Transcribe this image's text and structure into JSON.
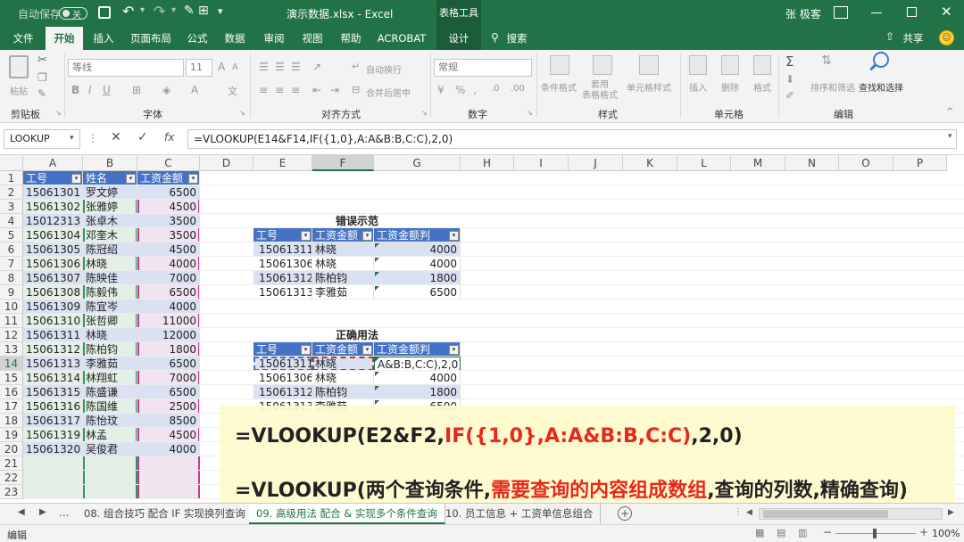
{
  "titlebar": {
    "autosave": "自动保存",
    "autosave_state": "关",
    "title": "演示数据.xlsx - Excel",
    "context_tab": "表格工具",
    "user": "张 极客"
  },
  "tabs": [
    "文件",
    "开始",
    "插入",
    "页面布局",
    "公式",
    "数据",
    "审阅",
    "视图",
    "帮助",
    "ACROBAT",
    "设计",
    "搜索"
  ],
  "tabs_right": {
    "share": "共享"
  },
  "ribbon": {
    "groups": [
      "剪贴板",
      "字体",
      "对齐方式",
      "数字",
      "样式",
      "单元格",
      "编辑"
    ],
    "paste": "粘贴",
    "font_name": "等线",
    "font_size": "11",
    "wrap": "自动换行",
    "merge": "合并后居中",
    "number_format": "常规",
    "cond_format": "条件格式",
    "table_format": "套用\n表格格式",
    "cell_style": "单元格样式",
    "insert": "插入",
    "delete": "删除",
    "format": "格式",
    "sort": "排序和筛选",
    "find": "查找和选择"
  },
  "formula_bar": {
    "name_box": "LOOKUP",
    "fx": "fx",
    "formula": "=VLOOKUP(E14&F14,IF({1,0},A:A&B:B,C:C),2,0)"
  },
  "columns": [
    "A",
    "B",
    "C",
    "D",
    "E",
    "F",
    "G",
    "H",
    "I",
    "J",
    "K",
    "L",
    "M",
    "N",
    "O",
    "P"
  ],
  "rows": [
    "1",
    "2",
    "3",
    "4",
    "5",
    "6",
    "7",
    "8",
    "9",
    "10",
    "11",
    "12",
    "13",
    "14",
    "15",
    "16",
    "17",
    "18",
    "19",
    "20",
    "21",
    "22",
    "23"
  ],
  "left_table": {
    "headers": [
      "工号",
      "姓名",
      "工资金额"
    ],
    "rows": [
      [
        "15061301",
        "罗文婷",
        "6500"
      ],
      [
        "15061302",
        "张雅婷",
        "4500"
      ],
      [
        "15012313",
        "张卓木",
        "3500"
      ],
      [
        "15061304",
        "邓奎木",
        "3500"
      ],
      [
        "15061305",
        "陈冠绍",
        "4500"
      ],
      [
        "15061306",
        "林晓",
        "4000"
      ],
      [
        "15061307",
        "陈映佳",
        "7000"
      ],
      [
        "15061308",
        "陈毅伟",
        "6500"
      ],
      [
        "15061309",
        "陈宜岑",
        "4000"
      ],
      [
        "15061310",
        "张哲卿",
        "11000"
      ],
      [
        "15061311",
        "林晓",
        "12000"
      ],
      [
        "15061312",
        "陈柏钧",
        "1800"
      ],
      [
        "15061313",
        "李雅茹",
        "6500"
      ],
      [
        "15061314",
        "林翔虹",
        "7000"
      ],
      [
        "15061315",
        "陈盛谦",
        "6500"
      ],
      [
        "15061316",
        "陈国维",
        "2500"
      ],
      [
        "15061317",
        "陈怡玟",
        "8500"
      ],
      [
        "15061319",
        "林孟",
        "4500"
      ],
      [
        "15061320",
        "吴俊君",
        "4000"
      ]
    ]
  },
  "wrong_table": {
    "title": "错误示范",
    "headers": [
      "工号",
      "工资金额",
      "工资金额判"
    ],
    "rows": [
      [
        "15061311",
        "林晓",
        "4000"
      ],
      [
        "15061306",
        "林晓",
        "4000"
      ],
      [
        "15061312",
        "陈柏钧",
        "1800"
      ],
      [
        "15061313",
        "李雅茹",
        "6500"
      ]
    ]
  },
  "right_table": {
    "title": "正确用法",
    "headers": [
      "工号",
      "工资金额",
      "工资金额判"
    ],
    "rows": [
      [
        "15061311",
        "林晓",
        "A&B:B,C:C),2,0)"
      ],
      [
        "15061306",
        "林晓",
        "4000"
      ],
      [
        "15061312",
        "陈柏钧",
        "1800"
      ],
      [
        "15061313",
        "李雅茹",
        "6500"
      ]
    ]
  },
  "overlay": {
    "line1_a": "=VLOOKUP(E2&F2,",
    "line1_b": "IF({1,0},A:A&B:B,C:C)",
    "line1_c": ",2,0)",
    "line2_a": "=VLOOKUP(两个查询条件,",
    "line2_b": "需要查询的内容组成数组",
    "line2_c": ",查询的列数,精确查询)"
  },
  "sheet_tabs": {
    "more": "...",
    "tabs": [
      "08. 组合技巧 配合 IF 实现换列查询",
      "09. 高级用法 配合 & 实现多个条件查询",
      "10. 员工信息 + 工资单信息组合"
    ],
    "active_index": 1
  },
  "status": {
    "mode": "编辑",
    "zoom": "100%"
  },
  "colors": {
    "excel_green": "#217346",
    "table_header": "#4472c4",
    "band": "#d9e1f2",
    "overlay_bg": "#fffbcc",
    "highlight_red": "#e8281b"
  }
}
